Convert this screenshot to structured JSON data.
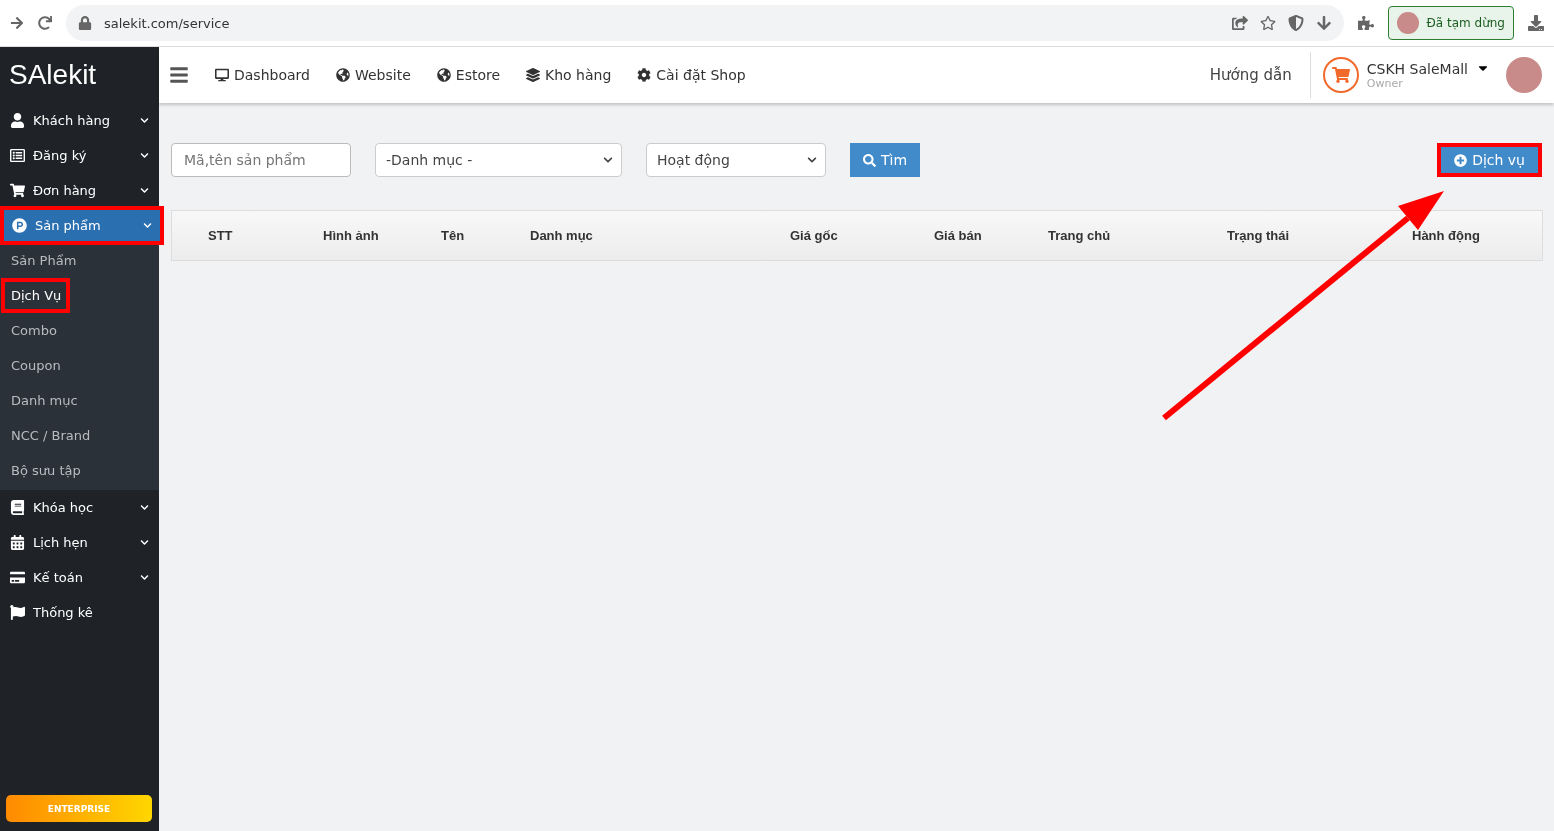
{
  "browser": {
    "url": "salekit.com/service",
    "profile_status": "Đã tạm dừng"
  },
  "sidebar": {
    "logo": "SAlekit",
    "items": [
      {
        "label": "Khách hàng",
        "expandable": true,
        "selected": false,
        "highlighted": false
      },
      {
        "label": "Đăng ký",
        "expandable": true,
        "selected": false,
        "highlighted": false
      },
      {
        "label": "Đơn hàng",
        "expandable": true,
        "selected": false,
        "highlighted": false
      },
      {
        "label": "Sản phẩm",
        "expandable": true,
        "selected": true,
        "highlighted": true,
        "children": [
          {
            "label": "Sản Phẩm",
            "selected": false,
            "highlighted": false
          },
          {
            "label": "Dịch Vụ",
            "selected": true,
            "highlighted": true
          },
          {
            "label": "Combo",
            "selected": false,
            "highlighted": false
          },
          {
            "label": "Coupon",
            "selected": false,
            "highlighted": false
          },
          {
            "label": "Danh mục",
            "selected": false,
            "highlighted": false
          },
          {
            "label": "NCC / Brand",
            "selected": false,
            "highlighted": false
          },
          {
            "label": "Bộ sưu tập",
            "selected": false,
            "highlighted": false
          }
        ]
      },
      {
        "label": "Khóa học",
        "expandable": true,
        "selected": false,
        "highlighted": false
      },
      {
        "label": "Lịch hẹn",
        "expandable": true,
        "selected": false,
        "highlighted": false
      },
      {
        "label": "Kế toán",
        "expandable": true,
        "selected": false,
        "highlighted": false
      },
      {
        "label": "Thống kê",
        "expandable": false,
        "selected": false,
        "highlighted": false
      }
    ],
    "plan_badge": "ENTERPRISE"
  },
  "header": {
    "nav": [
      "Dashboard",
      "Website",
      "Estore",
      "Kho hàng",
      "Cài đặt Shop"
    ],
    "help": "Hướng dẫn",
    "user": {
      "name": "CSKH SaleMall",
      "role": "Owner"
    }
  },
  "filters": {
    "search": {
      "placeholder": "Mã,tên sản phẩm"
    },
    "category": {
      "value": "-Danh mục -"
    },
    "status": {
      "value": "Hoạt động"
    },
    "search_button": "Tìm"
  },
  "add_button": {
    "label": "Dịch vụ",
    "highlighted": true
  },
  "table": {
    "columns": [
      "STT",
      "Hình ảnh",
      "Tên",
      "Danh mục",
      "Giá gốc",
      "Giá bán",
      "Trang chủ",
      "Trạng thái",
      "Hành động"
    ]
  }
}
